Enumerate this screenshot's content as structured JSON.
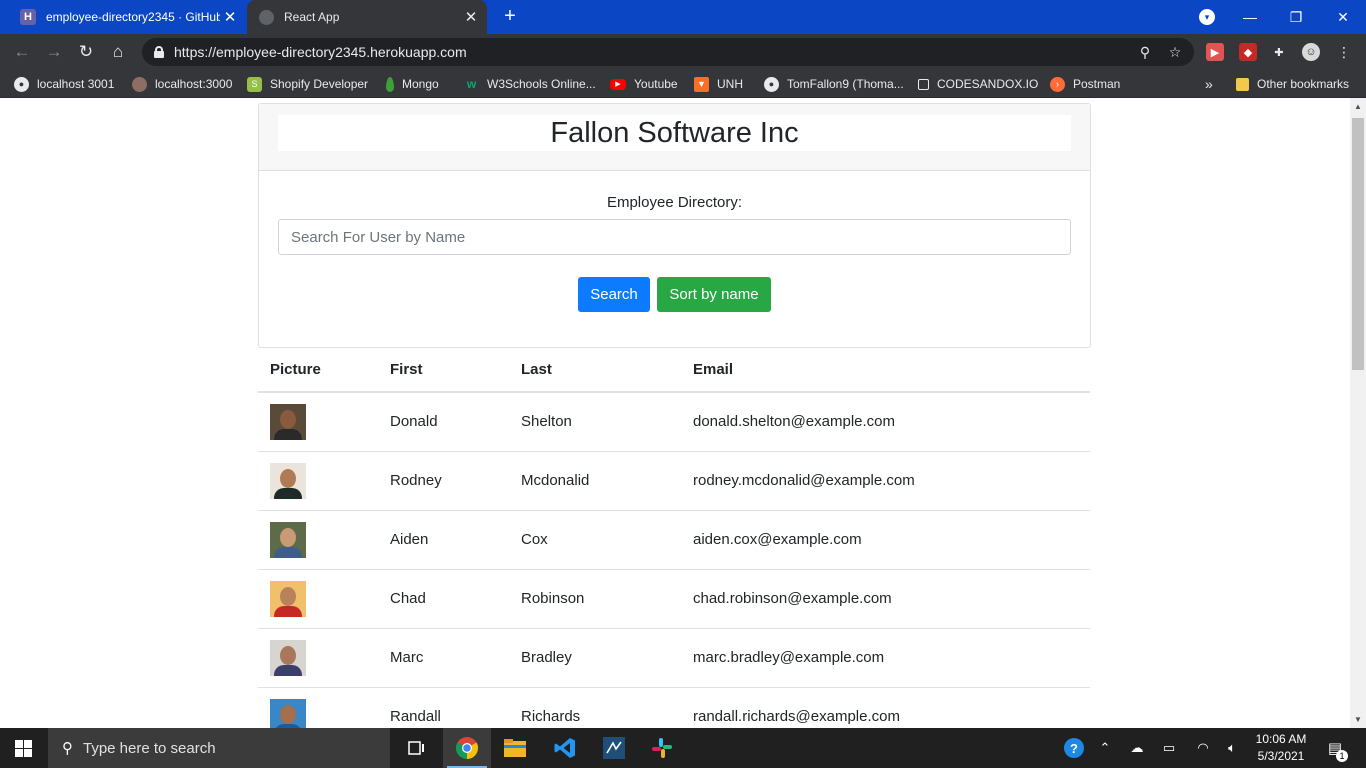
{
  "browser": {
    "tabs": [
      {
        "title": "employee-directory2345 · GitHub",
        "favicon": "heroku-icon",
        "active": false
      },
      {
        "title": "React App",
        "favicon": "globe-icon",
        "active": true
      }
    ],
    "new_tab_label": "+",
    "url": "https://employee-directory2345.herokuapp.com",
    "bookmarks": [
      {
        "label": "localhost 3001",
        "icon": "globe-icon"
      },
      {
        "label": "localhost:3000",
        "icon": "avatar-icon"
      },
      {
        "label": "Shopify Developer",
        "icon": "shopify-icon"
      },
      {
        "label": "Mongo",
        "icon": "leaf-icon"
      },
      {
        "label": "W3Schools Online...",
        "icon": "w3schools-icon"
      },
      {
        "label": "Youtube",
        "icon": "youtube-icon"
      },
      {
        "label": "UNH",
        "icon": "gitlab-icon"
      },
      {
        "label": "TomFallon9 (Thoma...",
        "icon": "github-icon"
      },
      {
        "label": "CODESANDOX.IO",
        "icon": "cube-icon"
      },
      {
        "label": "Postman",
        "icon": "postman-icon"
      }
    ],
    "bookmarks_overflow": "»",
    "other_bookmarks": "Other bookmarks"
  },
  "page": {
    "company_title": "Fallon Software Inc",
    "directory_label": "Employee Directory:",
    "search_placeholder": "Search For User by Name",
    "search_button": "Search",
    "sort_button": "Sort by name",
    "table": {
      "headers": [
        "Picture",
        "First",
        "Last",
        "Email"
      ],
      "rows": [
        {
          "first": "Donald",
          "last": "Shelton",
          "email": "donald.shelton@example.com",
          "bg": "#5a4a3a",
          "skin": "#8a5a3c",
          "shirt": "#2a2a2a"
        },
        {
          "first": "Rodney",
          "last": "Mcdonalid",
          "email": "rodney.mcdonalid@example.com",
          "bg": "#e9e4dc",
          "skin": "#b07a55",
          "shirt": "#1e2a26"
        },
        {
          "first": "Aiden",
          "last": "Cox",
          "email": "aiden.cox@example.com",
          "bg": "#5e6b48",
          "skin": "#c99a76",
          "shirt": "#3d5e8a"
        },
        {
          "first": "Chad",
          "last": "Robinson",
          "email": "chad.robinson@example.com",
          "bg": "#f0c06a",
          "skin": "#b8835c",
          "shirt": "#c62828"
        },
        {
          "first": "Marc",
          "last": "Bradley",
          "email": "marc.bradley@example.com",
          "bg": "#d8d4d0",
          "skin": "#a9785a",
          "shirt": "#3b3f6b"
        },
        {
          "first": "Randall",
          "last": "Richards",
          "email": "randall.richards@example.com",
          "bg": "#3a87c7",
          "skin": "#a36f4c",
          "shirt": "#1e5a99"
        }
      ]
    }
  },
  "taskbar": {
    "search_placeholder": "Type here to search",
    "time": "10:06 AM",
    "date": "5/3/2021",
    "notification_count": "1"
  }
}
